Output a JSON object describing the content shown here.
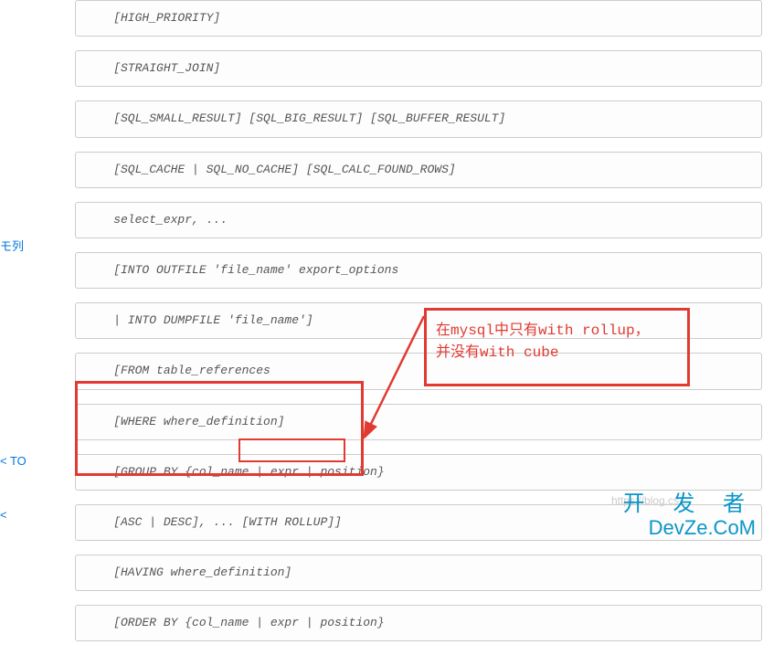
{
  "sidebar": {
    "link1": "モ列",
    "link2": "< TO",
    "link3": "<"
  },
  "code": {
    "b1": "    [HIGH_PRIORITY]",
    "b2": "    [STRAIGHT_JOIN]",
    "b3": "    [SQL_SMALL_RESULT] [SQL_BIG_RESULT] [SQL_BUFFER_RESULT]",
    "b4": "    [SQL_CACHE | SQL_NO_CACHE] [SQL_CALC_FOUND_ROWS]",
    "b5": "    select_expr, ...",
    "b6": "    [INTO OUTFILE 'file_name' export_options",
    "b7": "    | INTO DUMPFILE 'file_name']",
    "b8": "    [FROM table_references",
    "b9": "    [WHERE where_definition]",
    "b10": "    [GROUP BY {col_name | expr | position}",
    "b11": "    [ASC | DESC], ... [WITH ROLLUP]]",
    "b12": "    [HAVING where_definition]",
    "b13": "    [ORDER BY {col_name | expr | position}"
  },
  "annotation": "在mysql中只有with rollup，\n并没有with cube",
  "watermark": "https://blog.cs",
  "logo": {
    "top": "开 发 者",
    "bottom": "DevZe.CoM"
  }
}
